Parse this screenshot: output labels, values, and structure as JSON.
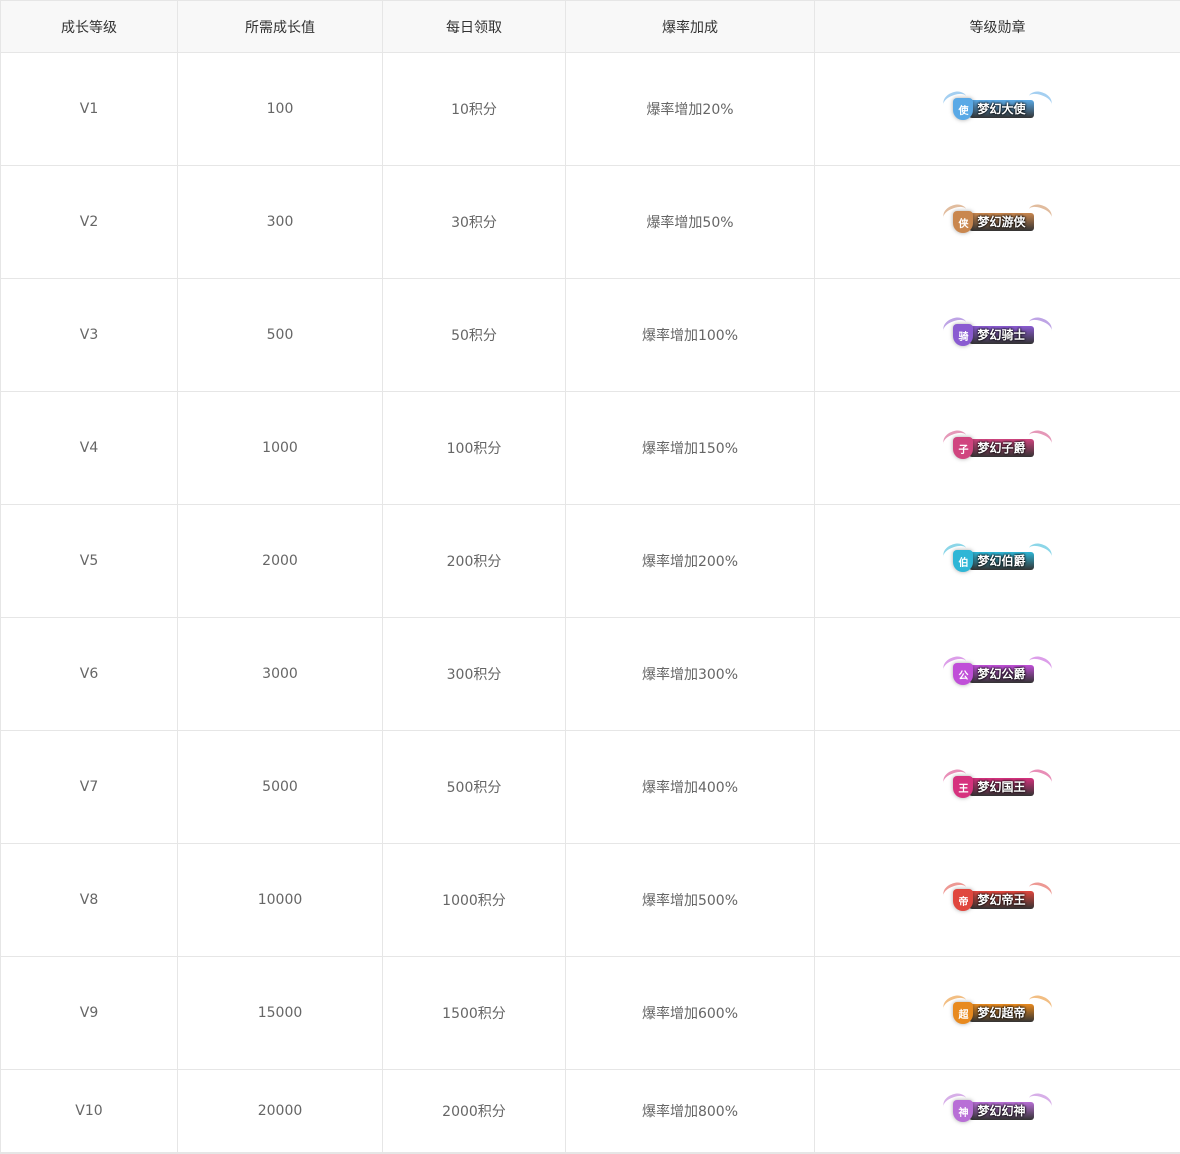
{
  "headers": [
    "成长等级",
    "所需成长值",
    "每日领取",
    "爆率加成",
    "等级勋章"
  ],
  "rows": [
    {
      "level": "V1",
      "growth": "100",
      "daily": "10积分",
      "bonus": "爆率增加20%",
      "badge": {
        "icon": "使",
        "name": "梦幻大使",
        "color": "#5aa9e6"
      }
    },
    {
      "level": "V2",
      "growth": "300",
      "daily": "30积分",
      "bonus": "爆率增加50%",
      "badge": {
        "icon": "侠",
        "name": "梦幻游侠",
        "color": "#c9874f"
      }
    },
    {
      "level": "V3",
      "growth": "500",
      "daily": "50积分",
      "bonus": "爆率增加100%",
      "badge": {
        "icon": "骑",
        "name": "梦幻骑士",
        "color": "#8a5bd1"
      }
    },
    {
      "level": "V4",
      "growth": "1000",
      "daily": "100积分",
      "bonus": "爆率增加150%",
      "badge": {
        "icon": "子",
        "name": "梦幻子爵",
        "color": "#d0457f"
      }
    },
    {
      "level": "V5",
      "growth": "2000",
      "daily": "200积分",
      "bonus": "爆率增加200%",
      "badge": {
        "icon": "伯",
        "name": "梦幻伯爵",
        "color": "#2fb6d6"
      }
    },
    {
      "level": "V6",
      "growth": "3000",
      "daily": "300积分",
      "bonus": "爆率增加300%",
      "badge": {
        "icon": "公",
        "name": "梦幻公爵",
        "color": "#c04fd8"
      }
    },
    {
      "level": "V7",
      "growth": "5000",
      "daily": "500积分",
      "bonus": "爆率增加400%",
      "badge": {
        "icon": "王",
        "name": "梦幻国王",
        "color": "#d6327e"
      }
    },
    {
      "level": "V8",
      "growth": "10000",
      "daily": "1000积分",
      "bonus": "爆率增加500%",
      "badge": {
        "icon": "帝",
        "name": "梦幻帝王",
        "color": "#e0473e"
      }
    },
    {
      "level": "V9",
      "growth": "15000",
      "daily": "1500积分",
      "bonus": "爆率增加600%",
      "badge": {
        "icon": "超",
        "name": "梦幻超帝",
        "color": "#e88a1f"
      }
    },
    {
      "level": "V10",
      "growth": "20000",
      "daily": "2000积分",
      "bonus": "爆率增加800%",
      "badge": {
        "icon": "神",
        "name": "梦幻幻神",
        "color": "#b86fd6"
      }
    }
  ]
}
